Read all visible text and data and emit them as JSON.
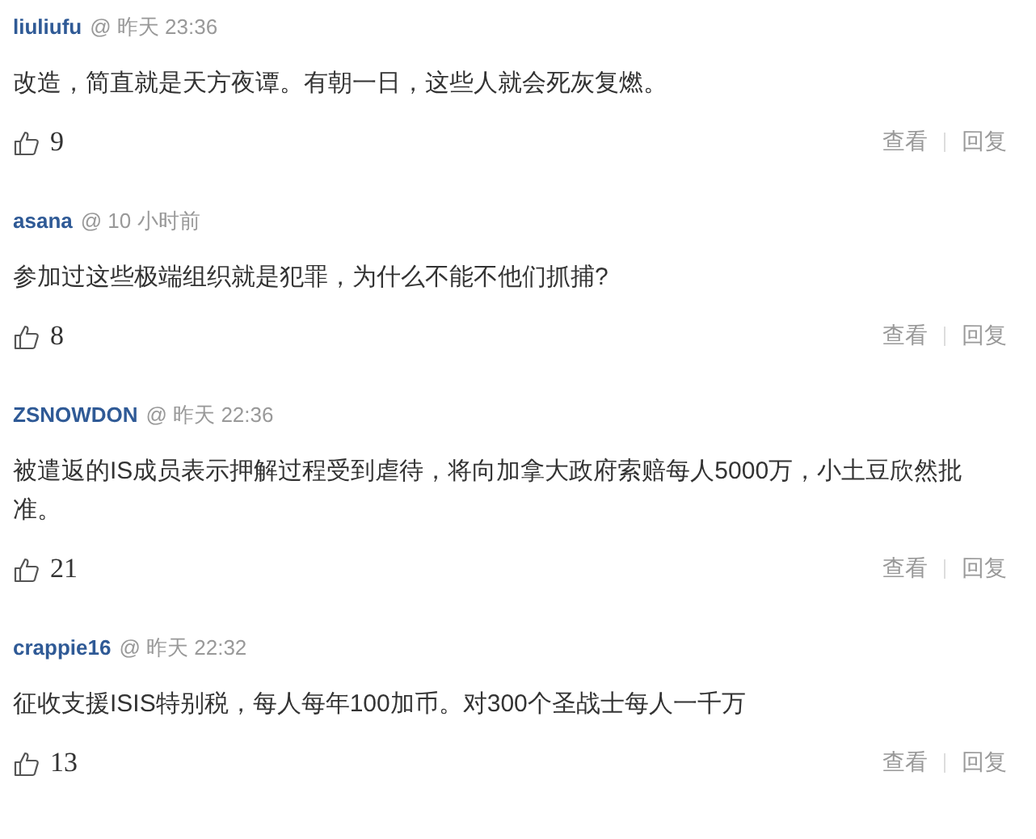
{
  "comments": [
    {
      "user": "liuliufu",
      "meta": "@ 昨天 23:36",
      "text": "改造，简直就是天方夜谭。有朝一日，这些人就会死灰复燃。",
      "likes": "9",
      "actions": [
        "查看",
        "回复"
      ]
    },
    {
      "user": "asana",
      "meta": "@ 10 小时前",
      "text": "参加过这些极端组织就是犯罪，为什么不能不他们抓捕?",
      "likes": "8",
      "actions": [
        "查看",
        "回复"
      ]
    },
    {
      "user": "ZSNOWDON",
      "meta": "@ 昨天 22:36",
      "text": "被遣返的IS成员表示押解过程受到虐待，将向加拿大政府索赔每人5000万，小土豆欣然批准。",
      "likes": "21",
      "actions": [
        "查看",
        "回复"
      ]
    },
    {
      "user": "crappie16",
      "meta": "@ 昨天 22:32",
      "text": "征收支援ISIS特别税，每人每年100加币。对300个圣战士每人一千万",
      "likes": "13",
      "actions": [
        "查看",
        "回复"
      ]
    }
  ]
}
